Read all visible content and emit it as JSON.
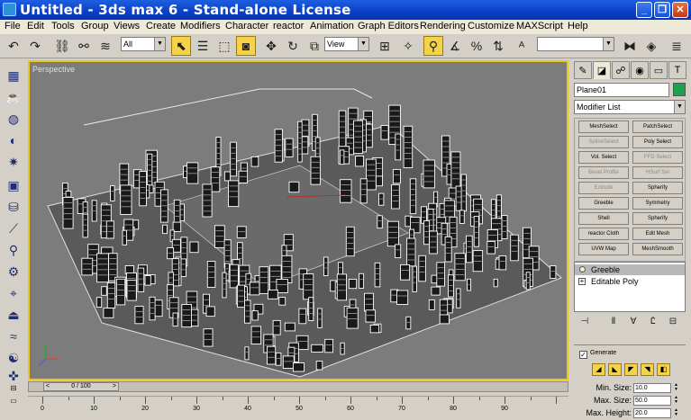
{
  "window": {
    "title": "Untitled - 3ds max 6 - Stand-alone License",
    "minimize": "_",
    "restore": "❐",
    "close": "✕"
  },
  "menu": [
    "File",
    "Edit",
    "Tools",
    "Group",
    "Views",
    "Create",
    "Modifiers",
    "Character",
    "reactor",
    "Animation",
    "Graph Editors",
    "Rendering",
    "Customize",
    "MAXScript",
    "Help"
  ],
  "toolbar": {
    "selection_filter": "All",
    "reference_coord": "View",
    "named_selection": ""
  },
  "viewport": {
    "label": "Perspective"
  },
  "command_panel": {
    "object_name": "Plane01",
    "object_color": "#1ca24a",
    "modifier_list": "Modifier List",
    "modifier_buttons": [
      {
        "label": "MeshSelect",
        "enabled": true
      },
      {
        "label": "PatchSelect",
        "enabled": true
      },
      {
        "label": "SplineSelect",
        "enabled": false
      },
      {
        "label": "Poly Select",
        "enabled": true
      },
      {
        "label": "Vol. Select",
        "enabled": true
      },
      {
        "label": "FFD Select",
        "enabled": false
      },
      {
        "label": "Bevel Profile",
        "enabled": false
      },
      {
        "label": "HSurf Sel",
        "enabled": false
      },
      {
        "label": "Extrude",
        "enabled": false
      },
      {
        "label": "Spherify",
        "enabled": true
      },
      {
        "label": "Greeble",
        "enabled": true
      },
      {
        "label": "Symmetry",
        "enabled": true
      },
      {
        "label": "Shell",
        "enabled": true
      },
      {
        "label": "Spherify",
        "enabled": true
      },
      {
        "label": "reactor Cloth",
        "enabled": true
      },
      {
        "label": "Edit Mesh",
        "enabled": true
      },
      {
        "label": "UVW Map",
        "enabled": true
      },
      {
        "label": "MeshSmooth",
        "enabled": true
      }
    ],
    "stack": [
      {
        "label": "Greeble",
        "selected": true
      },
      {
        "label": "Editable Poly",
        "selected": false
      }
    ],
    "params": {
      "generate_label": "Generate",
      "generate_checked": true,
      "rows": [
        {
          "label": "Min. Size:",
          "value": "10.0"
        },
        {
          "label": "Max. Size:",
          "value": "50.0"
        },
        {
          "label": "Max. Height:",
          "value": "20.0"
        }
      ]
    }
  },
  "timeline": {
    "frame_label": "0 / 100",
    "ticks": [
      "0",
      "10",
      "20",
      "30",
      "40",
      "50",
      "60",
      "70",
      "80",
      "90"
    ]
  }
}
